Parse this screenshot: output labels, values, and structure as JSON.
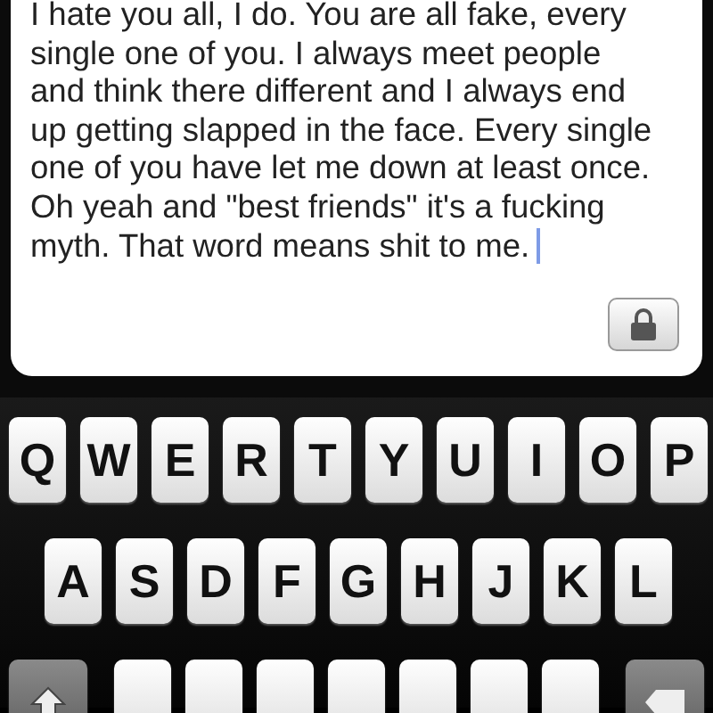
{
  "note": {
    "text": "I hate you all,  I do. You are all fake, every single one of you. I always meet people and think there different and I always end up getting slapped in the face. Every single one of you have let me down at least once. Oh yeah and \"best friends\" it's a fucking myth. That word means shit to me.",
    "cursor": true
  },
  "lock_button": {
    "kind": "lock"
  },
  "keyboard": {
    "rows": [
      [
        {
          "kind": "letter",
          "label": "Q"
        },
        {
          "kind": "letter",
          "label": "W"
        },
        {
          "kind": "letter",
          "label": "E"
        },
        {
          "kind": "letter",
          "label": "R"
        },
        {
          "kind": "letter",
          "label": "T"
        },
        {
          "kind": "letter",
          "label": "Y"
        },
        {
          "kind": "letter",
          "label": "U"
        },
        {
          "kind": "letter",
          "label": "I"
        },
        {
          "kind": "letter",
          "label": "O"
        },
        {
          "kind": "letter",
          "label": "P"
        }
      ],
      [
        {
          "kind": "letter",
          "label": "A"
        },
        {
          "kind": "letter",
          "label": "S"
        },
        {
          "kind": "letter",
          "label": "D"
        },
        {
          "kind": "letter",
          "label": "F"
        },
        {
          "kind": "letter",
          "label": "G"
        },
        {
          "kind": "letter",
          "label": "H"
        },
        {
          "kind": "letter",
          "label": "J"
        },
        {
          "kind": "letter",
          "label": "K"
        },
        {
          "kind": "letter",
          "label": "L"
        }
      ],
      [
        {
          "kind": "shift"
        },
        {
          "kind": "letter"
        },
        {
          "kind": "letter"
        },
        {
          "kind": "letter"
        },
        {
          "kind": "letter"
        },
        {
          "kind": "letter"
        },
        {
          "kind": "letter"
        },
        {
          "kind": "letter"
        },
        {
          "kind": "delete"
        }
      ]
    ]
  }
}
